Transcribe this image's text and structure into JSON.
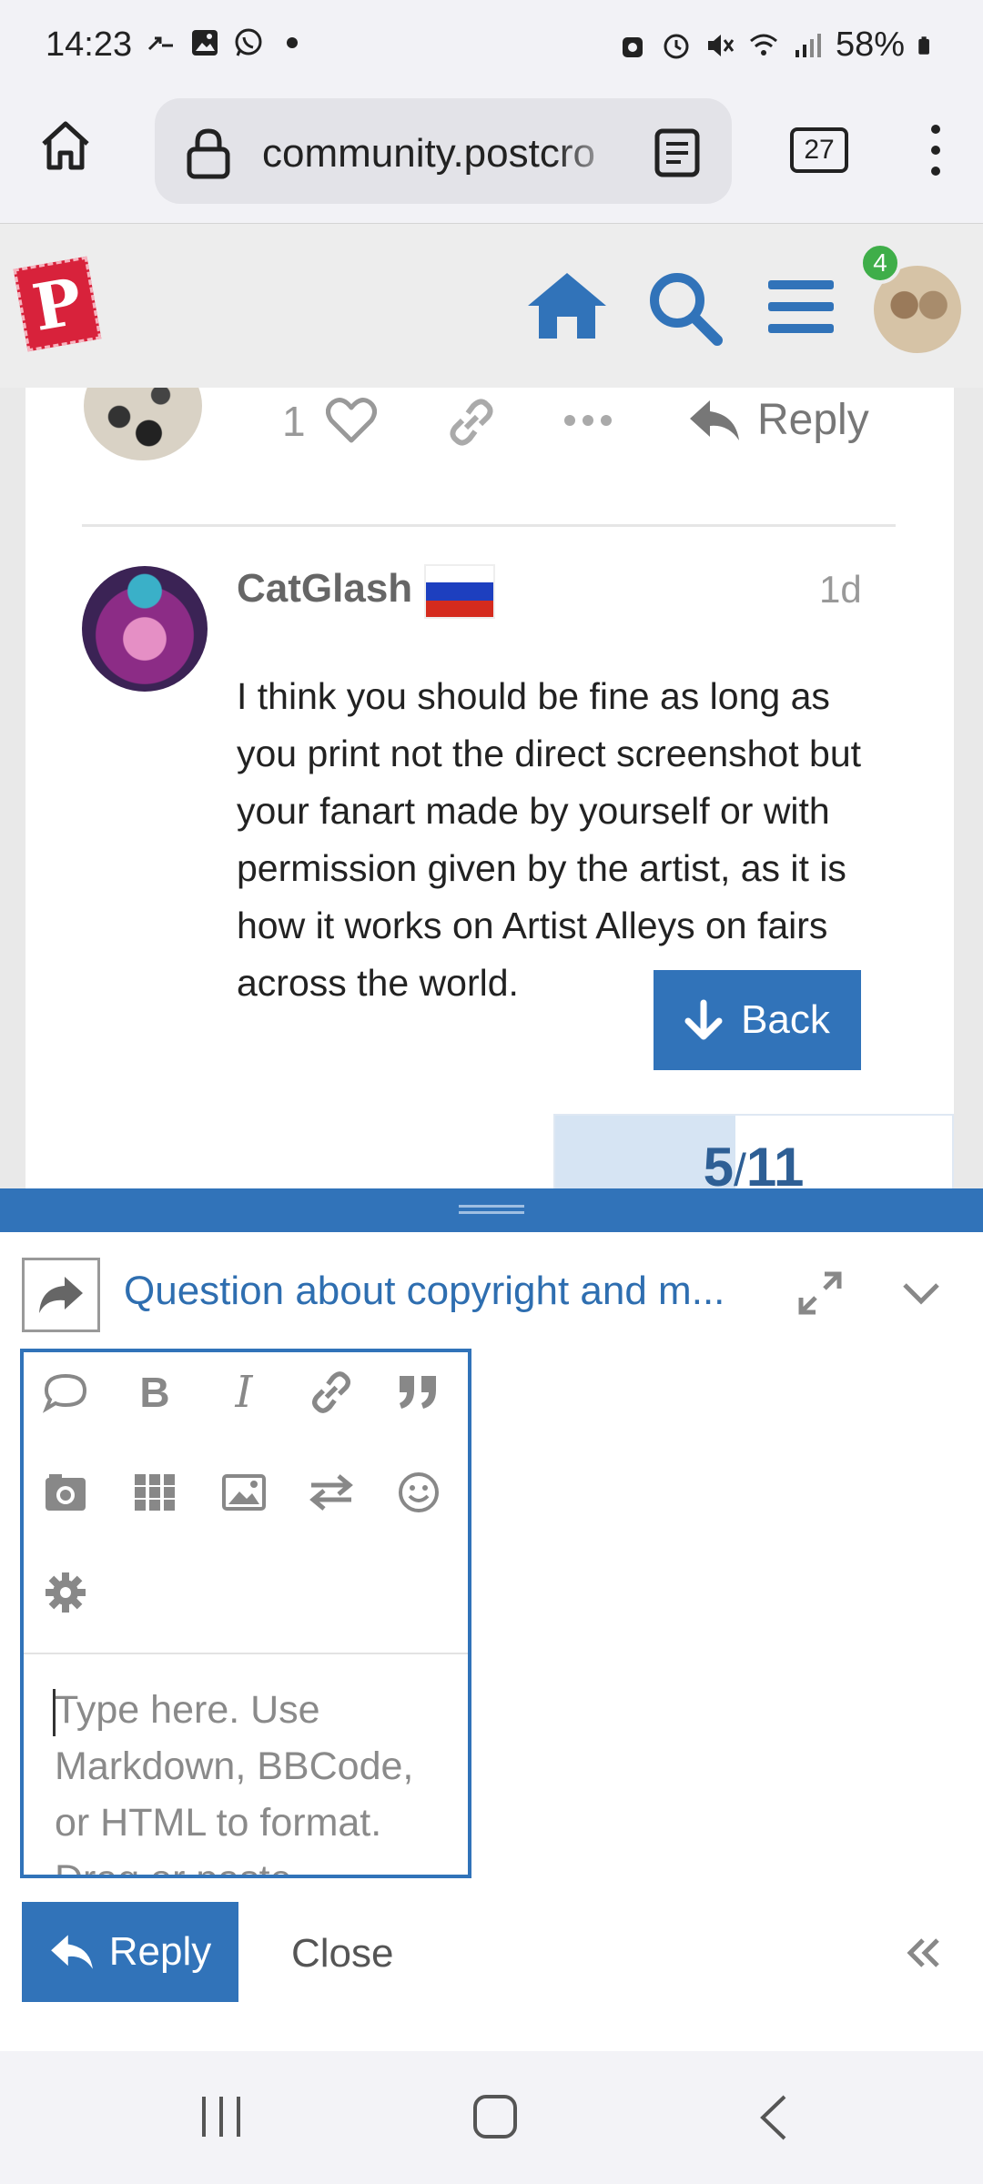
{
  "status_bar": {
    "time": "14:23",
    "battery": "58%"
  },
  "browser": {
    "url": "community.postcro",
    "tab_count": "27"
  },
  "site": {
    "logo_letter": "P",
    "notification_count": "4"
  },
  "prev_post": {
    "like_count": "1",
    "reply_label": "Reply"
  },
  "post": {
    "author": "CatGlash",
    "age": "1d",
    "body": "I think you should be fine as long as you print not the direct screenshot but your fanart made by yourself or with permission given by the artist, as it is how it works on Artist Alleys on fairs across the world."
  },
  "back_button": {
    "label": "Back"
  },
  "progress": {
    "current": "5",
    "separator": "/",
    "total": "11",
    "fraction": 0.4545
  },
  "composer": {
    "topic_title": "Question about copyright and m...",
    "placeholder": "Type here. Use Markdown, BBCode, or HTML to format.",
    "placeholder_cut": "Drag or paste",
    "reply_label": "Reply",
    "close_label": "Close"
  },
  "colors": {
    "accent": "#3173b9",
    "logo_red": "#d8223b",
    "badge_green": "#3fae49"
  }
}
